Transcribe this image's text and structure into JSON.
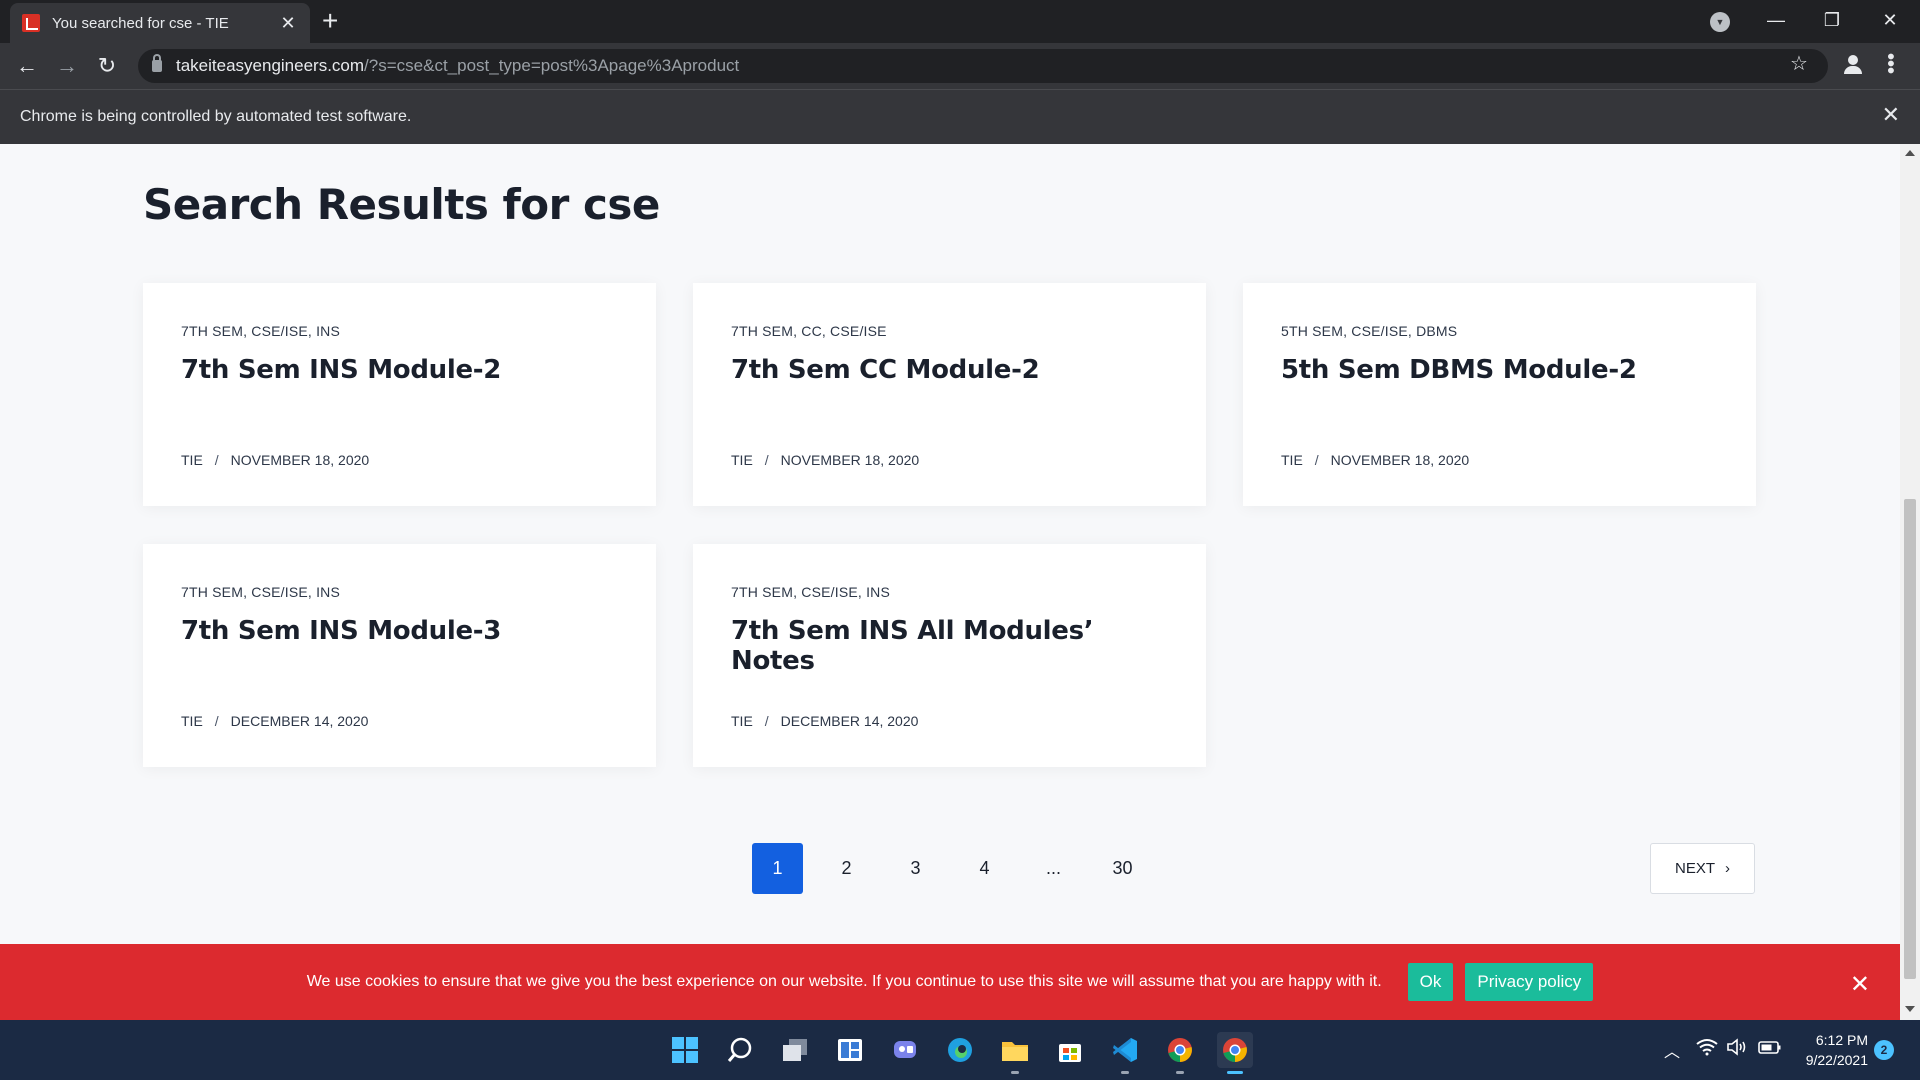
{
  "browser": {
    "tab_title": "You searched for cse - TIE",
    "url_host": "takeiteasyengineers.com",
    "url_path": "/?s=cse&ct_post_type=post%3Apage%3Aproduct",
    "infobar_text": "Chrome is being controlled by automated test software."
  },
  "page": {
    "title": "Search Results for cse",
    "cards": [
      {
        "categories": "7TH SEM, CSE/ISE, INS",
        "title": "7th Sem INS Module-2",
        "author": "TIE",
        "sep": "/",
        "date": "NOVEMBER 18, 2020"
      },
      {
        "categories": "7TH SEM, CC, CSE/ISE",
        "title": "7th Sem CC Module-2",
        "author": "TIE",
        "sep": "/",
        "date": "NOVEMBER 18, 2020"
      },
      {
        "categories": "5TH SEM, CSE/ISE, DBMS",
        "title": "5th Sem DBMS Module-2",
        "author": "TIE",
        "sep": "/",
        "date": "NOVEMBER 18, 2020"
      },
      {
        "categories": "7TH SEM, CSE/ISE, INS",
        "title": "7th Sem INS Module-3",
        "author": "TIE",
        "sep": "/",
        "date": "DECEMBER 14, 2020"
      },
      {
        "categories": "7TH SEM, CSE/ISE, INS",
        "title": "7th Sem INS All Modules’ Notes",
        "author": "TIE",
        "sep": "/",
        "date": "DECEMBER 14, 2020"
      }
    ],
    "pagination": {
      "pages": [
        "1",
        "2",
        "3",
        "4",
        "...",
        "30"
      ],
      "current": "1",
      "next_label": "NEXT",
      "next_icon": "chevron-right-icon"
    }
  },
  "cookie": {
    "text": "We use cookies to ensure that we give you the best experience on our website. If you continue to use this site we will assume that you are happy with it.",
    "ok_label": "Ok",
    "privacy_label": "Privacy policy"
  },
  "taskbar": {
    "time": "6:12 PM",
    "date": "9/22/2021",
    "notification_count": "2",
    "apps": [
      "start-icon",
      "search-icon",
      "task-view-icon",
      "widgets-icon",
      "chat-icon",
      "edge-icon",
      "file-explorer-icon",
      "store-icon",
      "vscode-icon",
      "chrome-icon",
      "chrome-icon"
    ]
  },
  "colors": {
    "accent_blue": "#1360e0",
    "cookie_red": "#dc2a2f",
    "cookie_button": "#1bbc9b",
    "taskbar": "#1b2a44"
  }
}
